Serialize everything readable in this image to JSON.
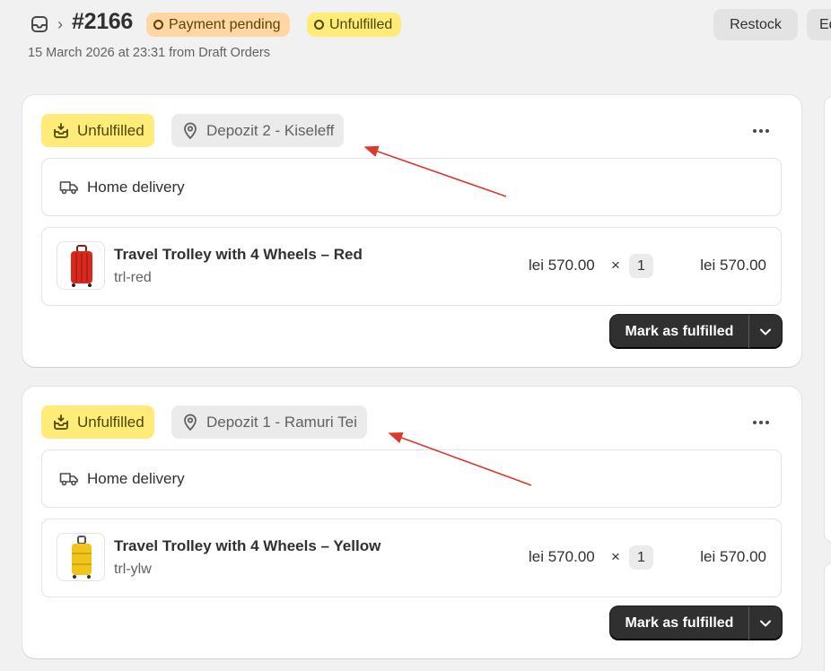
{
  "header": {
    "order_number": "#2166",
    "breadcrumb_separator": "›",
    "payment_badge": "Payment pending",
    "fulfillment_badge": "Unfulfilled",
    "subtitle": "15 March 2026 at 23:31 from Draft Orders",
    "restock_label": "Restock",
    "edit_label": "Edit"
  },
  "fulfillments": [
    {
      "status": "Unfulfilled",
      "location": "Depozit 2 - Kiseleff",
      "delivery_method": "Home delivery",
      "item": {
        "title": "Travel Trolley with 4 Wheels – Red",
        "sku": "trl-red",
        "unit_price": "lei 570.00",
        "times": "×",
        "quantity": "1",
        "total": "lei 570.00",
        "color": "#d9281e"
      },
      "action_label": "Mark as fulfilled"
    },
    {
      "status": "Unfulfilled",
      "location": "Depozit 1 - Ramuri Tei",
      "delivery_method": "Home delivery",
      "item": {
        "title": "Travel Trolley with 4 Wheels – Yellow",
        "sku": "trl-ylw",
        "unit_price": "lei 570.00",
        "times": "×",
        "quantity": "1",
        "total": "lei 570.00",
        "color": "#f0c419"
      },
      "action_label": "Mark as fulfilled"
    }
  ],
  "colors": {
    "unfulfilled_badge": "#ffeb78",
    "payment_badge": "#ffd6a4",
    "primary_button": "#303030",
    "annotation_arrow": "#d93a2b"
  }
}
